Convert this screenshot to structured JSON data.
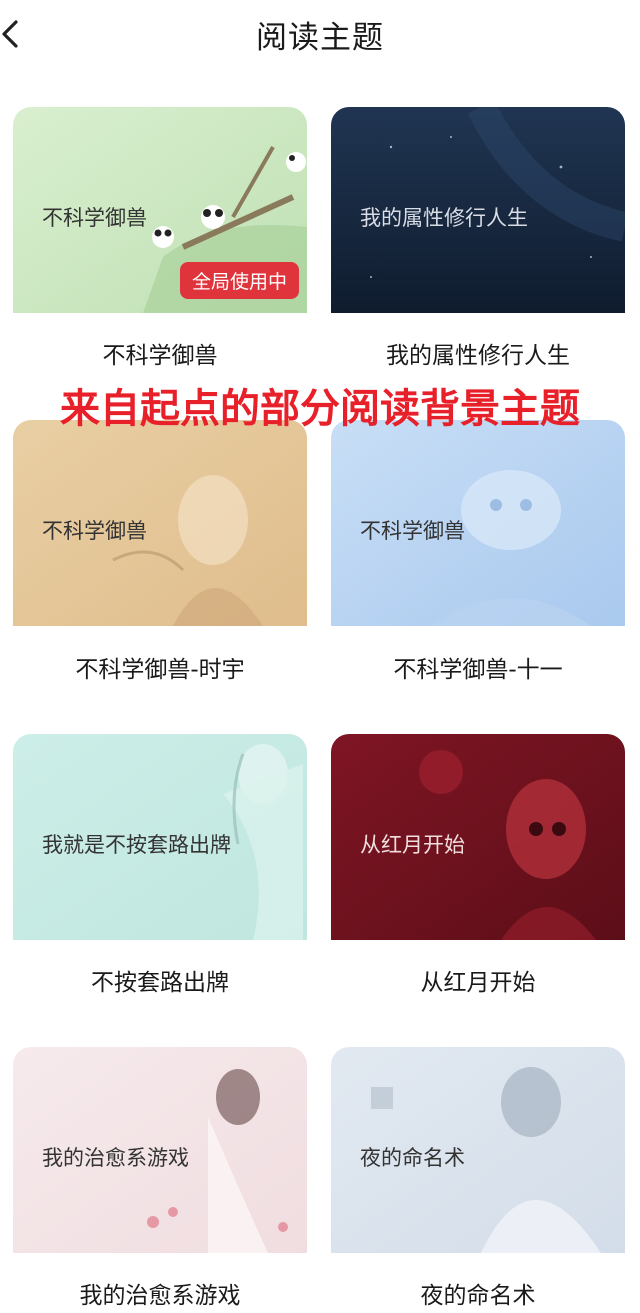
{
  "header": {
    "title": "阅读主题"
  },
  "annotation": "来自起点的部分阅读背景主题",
  "themes": [
    {
      "card_text": "不科学御兽",
      "caption": "不科学御兽",
      "badge": "全局使用中",
      "bg": "#cfe8c4"
    },
    {
      "card_text": "我的属性修行人生",
      "caption": "我的属性修行人生",
      "bg": "#1c2d45"
    },
    {
      "card_text": "不科学御兽",
      "caption": "不科学御兽-时宇",
      "bg": "#e6c99d"
    },
    {
      "card_text": "不科学御兽",
      "caption": "不科学御兽-十一",
      "bg": "#bcd6f2"
    },
    {
      "card_text": "我就是不按套路出牌",
      "caption": "不按套路出牌",
      "bg": "#c6ece6"
    },
    {
      "card_text": "从红月开始",
      "caption": "从红月开始",
      "bg": "#7a1422"
    },
    {
      "card_text": "我的治愈系游戏",
      "caption": "我的治愈系游戏",
      "bg": "#f4e6e8"
    },
    {
      "card_text": "夜的命名术",
      "caption": "夜的命名术",
      "bg": "#dbe4ee"
    }
  ]
}
